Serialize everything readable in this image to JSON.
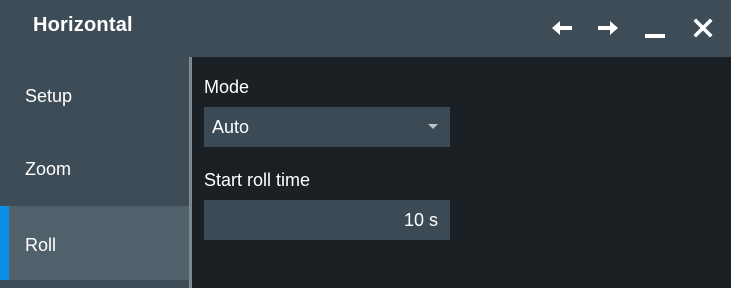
{
  "window": {
    "title": "Horizontal"
  },
  "title_buttons": {
    "back_icon": "arrow-left-icon",
    "forward_icon": "arrow-right-icon",
    "minimize_icon": "minimize-icon",
    "close_icon": "close-icon"
  },
  "sidebar": {
    "items": [
      {
        "label": "Setup",
        "active": false
      },
      {
        "label": "Zoom",
        "active": false
      },
      {
        "label": "Roll",
        "active": true
      }
    ]
  },
  "main": {
    "mode": {
      "label": "Mode",
      "value": "Auto"
    },
    "start_roll_time": {
      "label": "Start roll time",
      "value": "10 s"
    }
  },
  "colors": {
    "titlebar_bg": "#3d4c56",
    "sidebar_bg": "#3d4c56",
    "active_tab_bg": "#51616b",
    "accent": "#0d8ee8",
    "content_bg": "#1b2024",
    "field_bg": "#3b4a54",
    "text": "#ffffff"
  }
}
